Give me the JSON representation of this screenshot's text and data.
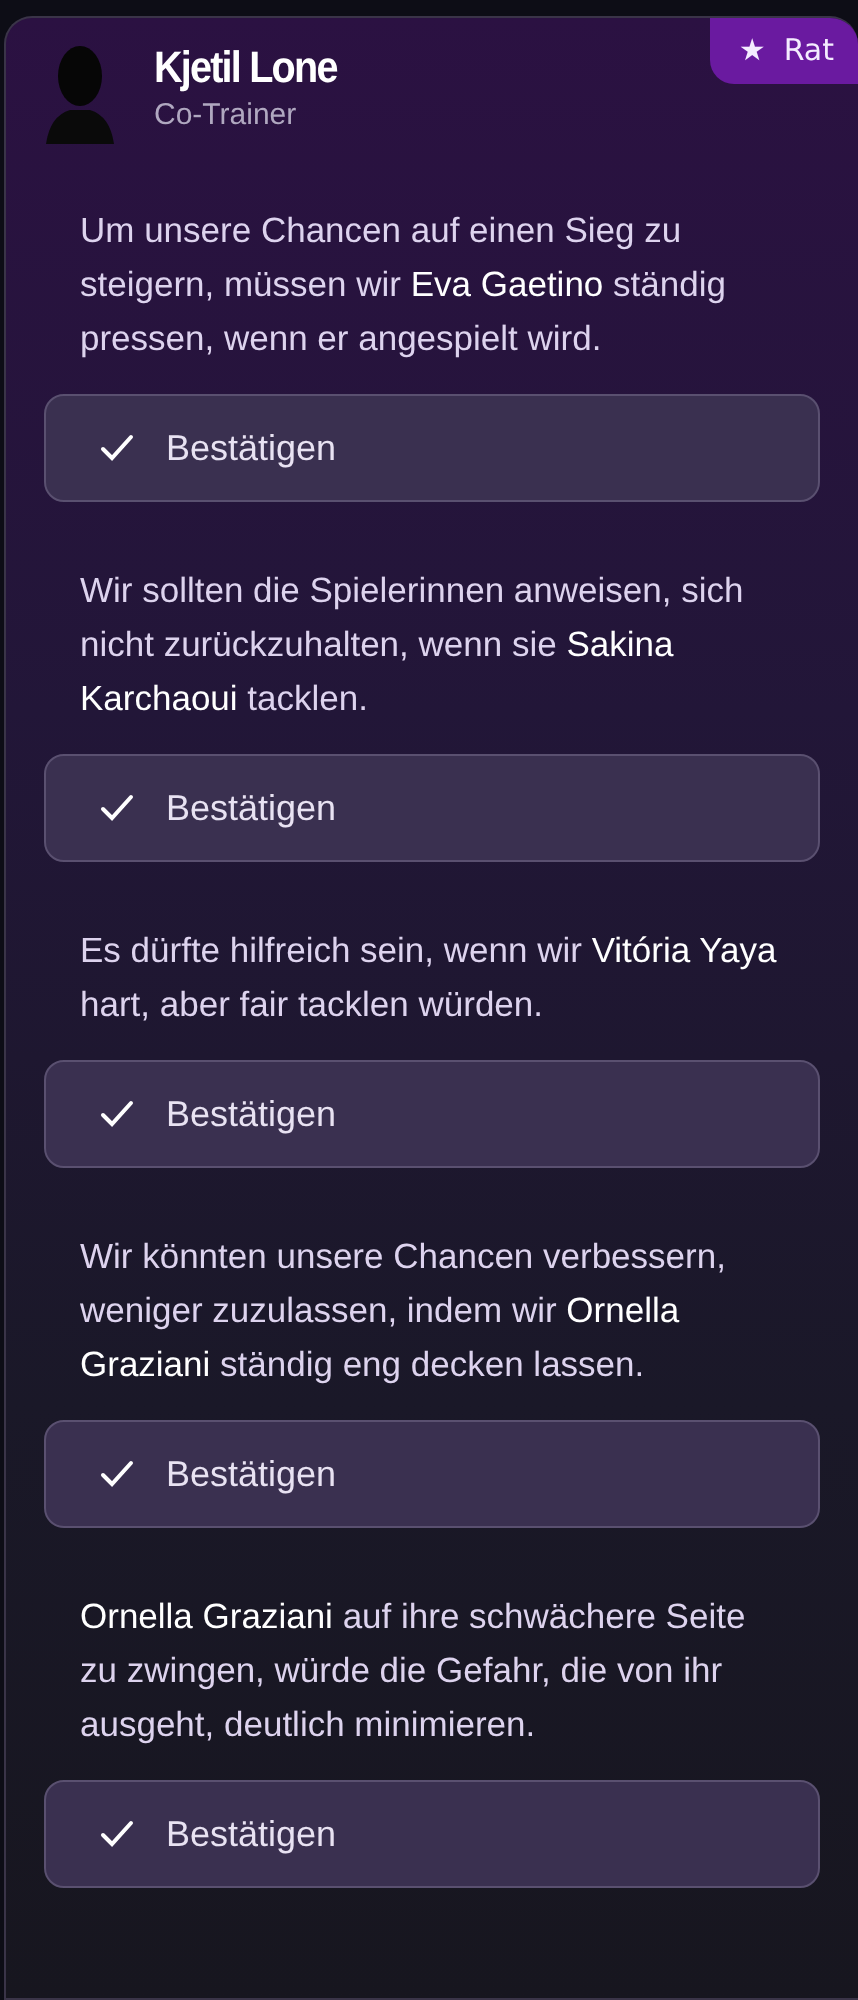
{
  "advisor": {
    "name": "Kjetil Lone",
    "role": "Co-Trainer"
  },
  "badge": {
    "icon": "★",
    "label": "Rat"
  },
  "advice": [
    {
      "text": "Um unsere Chancen auf einen Sieg zu steigern, müssen wir **Eva Gaetino** ständig pressen, wenn er angespielt wird.",
      "button": "Bestätigen"
    },
    {
      "text": "Wir sollten die Spielerinnen anweisen, sich nicht zurückzuhalten, wenn sie **Sakina Karchaoui** tacklen.",
      "button": "Bestätigen"
    },
    {
      "text": "Es dürfte hilfreich sein, wenn wir **Vitória Yaya** hart, aber fair tacklen würden.",
      "button": "Bestätigen"
    },
    {
      "text": "Wir könnten unsere Chancen verbessern, weniger zuzulassen, indem wir **Ornella Graziani** ständig eng decken lassen.",
      "button": "Bestätigen"
    },
    {
      "text": "**Ornella Graziani** auf ihre schwächere Seite zu zwingen, würde die Gefahr, die von ihr ausgeht, deutlich minimieren.",
      "button": "Bestätigen"
    }
  ]
}
